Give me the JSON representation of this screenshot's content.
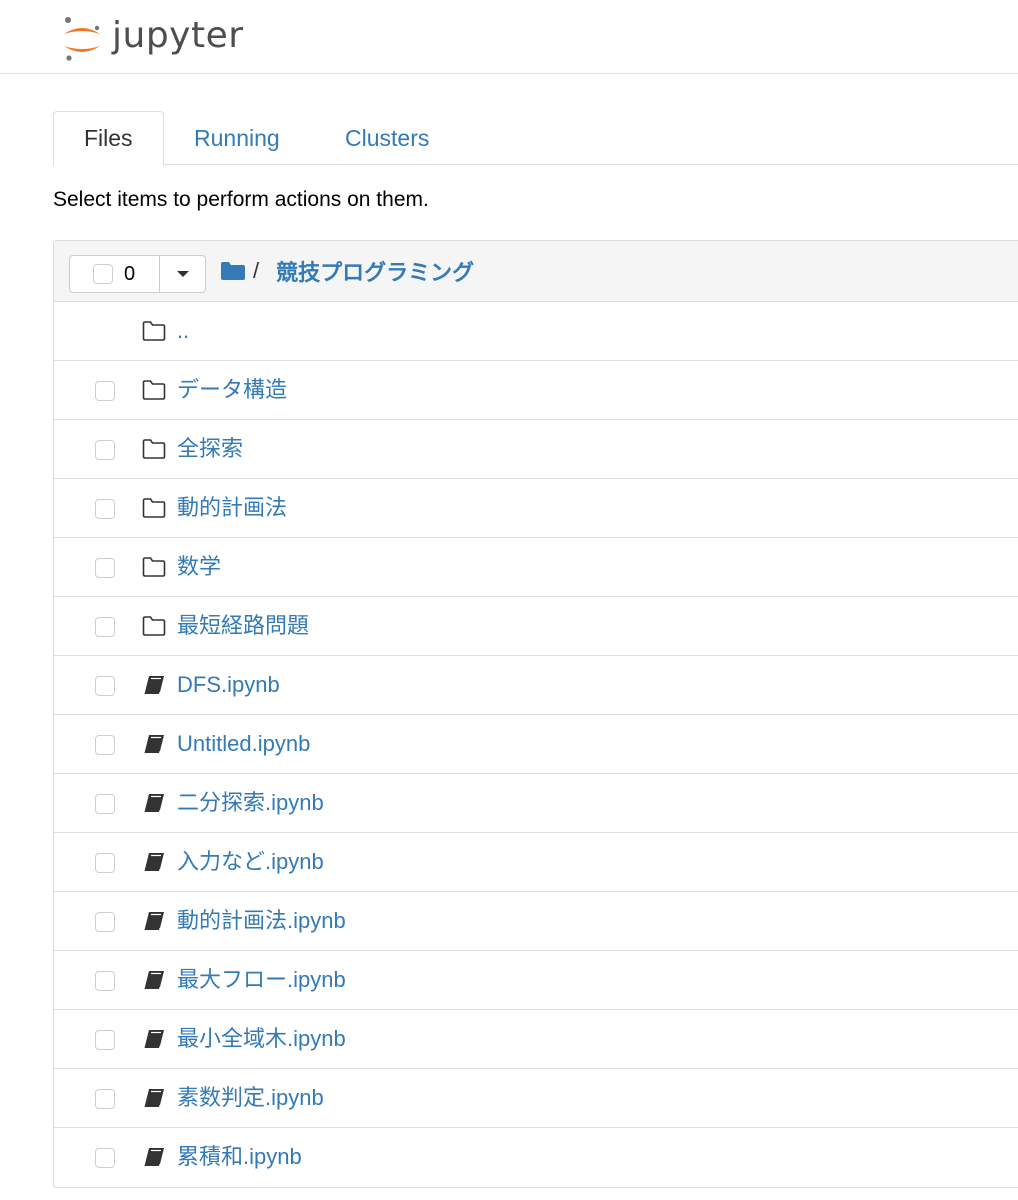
{
  "header": {
    "logo_text": "jupyter"
  },
  "tabs": [
    {
      "label": "Files",
      "active": true
    },
    {
      "label": "Running",
      "active": false
    },
    {
      "label": "Clusters",
      "active": false
    }
  ],
  "hint": "Select items to perform actions on them.",
  "toolbar": {
    "selected_count": "0",
    "breadcrumb_sep": "/",
    "current_dir": "競技プログラミング"
  },
  "items": [
    {
      "name": "..",
      "type": "folder",
      "checkbox": false
    },
    {
      "name": "データ構造",
      "type": "folder",
      "checkbox": true
    },
    {
      "name": "全探索",
      "type": "folder",
      "checkbox": true
    },
    {
      "name": "動的計画法",
      "type": "folder",
      "checkbox": true
    },
    {
      "name": "数学",
      "type": "folder",
      "checkbox": true
    },
    {
      "name": "最短経路問題",
      "type": "folder",
      "checkbox": true
    },
    {
      "name": "DFS.ipynb",
      "type": "notebook",
      "checkbox": true
    },
    {
      "name": "Untitled.ipynb",
      "type": "notebook",
      "checkbox": true
    },
    {
      "name": "二分探索.ipynb",
      "type": "notebook",
      "checkbox": true
    },
    {
      "name": "入力など.ipynb",
      "type": "notebook",
      "checkbox": true
    },
    {
      "name": "動的計画法.ipynb",
      "type": "notebook",
      "checkbox": true
    },
    {
      "name": "最大フロー.ipynb",
      "type": "notebook",
      "checkbox": true
    },
    {
      "name": "最小全域木.ipynb",
      "type": "notebook",
      "checkbox": true
    },
    {
      "name": "素数判定.ipynb",
      "type": "notebook",
      "checkbox": true
    },
    {
      "name": "累積和.ipynb",
      "type": "notebook",
      "checkbox": true
    }
  ],
  "colors": {
    "link": "#337ab7",
    "logo_orange": "#f37726",
    "logo_gray": "#767677"
  }
}
